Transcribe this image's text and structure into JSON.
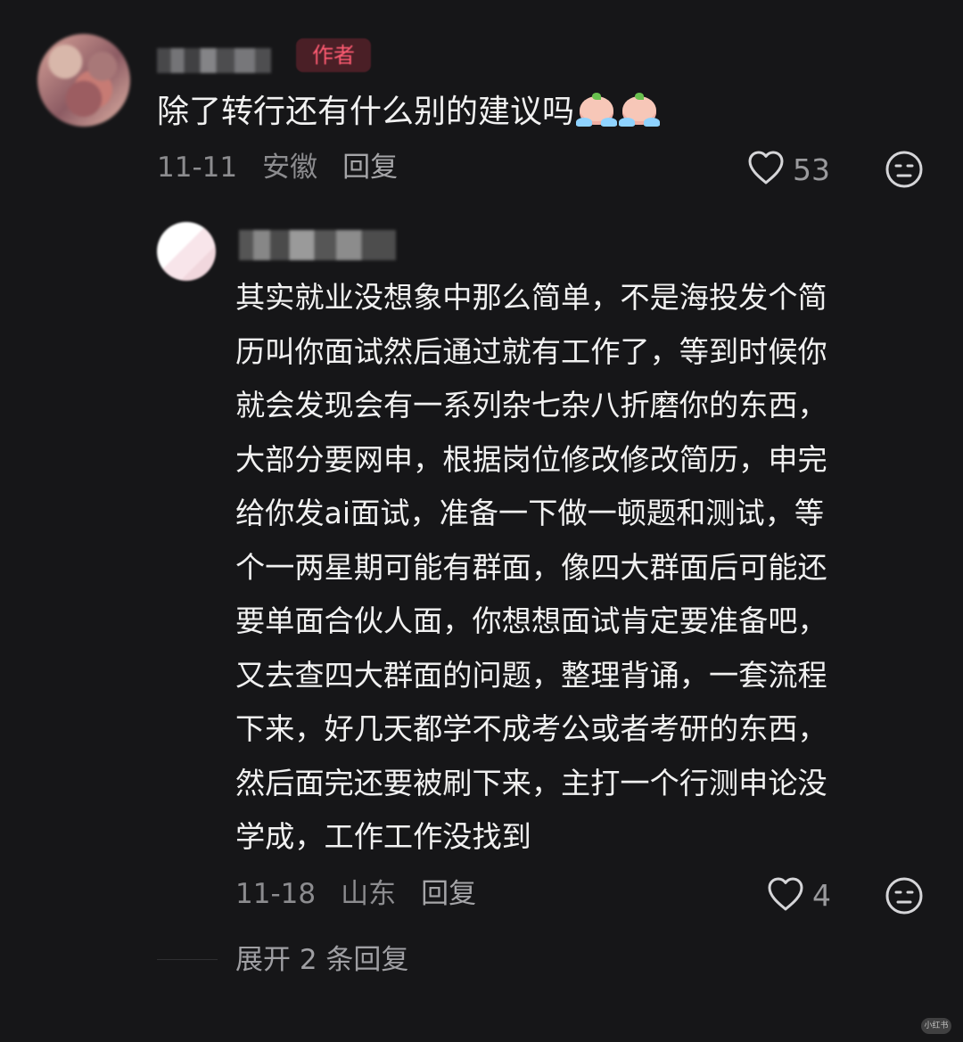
{
  "comment": {
    "author_badge": "作者",
    "text": "除了转行还有什么别的建议吗",
    "emoji": [
      "sad-tears-emoji-icon",
      "crying-emoji-icon"
    ],
    "date": "11-11",
    "location": "安徽",
    "reply_label": "回复",
    "likes": "53"
  },
  "reply": {
    "lines": [
      "其实就业没想象中那么简单，不是海投发个简",
      "历叫你面试然后通过就有工作了，等到时候你",
      "就会发现会有一系列杂七杂八折磨你的东西，",
      "大部分要网申，根据岗位修改修改简历，申完",
      "给你发ai面试，准备一下做一顿题和测试，等",
      "个一两星期可能有群面，像四大群面后可能还",
      "要单面合伙人面，你想想面试肯定要准备吧，",
      "又去查四大群面的问题，整理背诵，一套流程",
      "下来，好几天都学不成考公或者考研的东西，",
      "然后面完还要被刷下来，主打一个行测申论没",
      "学成，工作工作没找到"
    ],
    "date": "11-18",
    "location": "山东",
    "reply_label": "回复",
    "likes": "4"
  },
  "thread": {
    "expand_text": "展开 2 条回复"
  },
  "watermark": "小红书",
  "colors": {
    "background": "#161618",
    "author_badge_text": "#ff5b72",
    "author_badge_bg": "#4a1f26"
  }
}
